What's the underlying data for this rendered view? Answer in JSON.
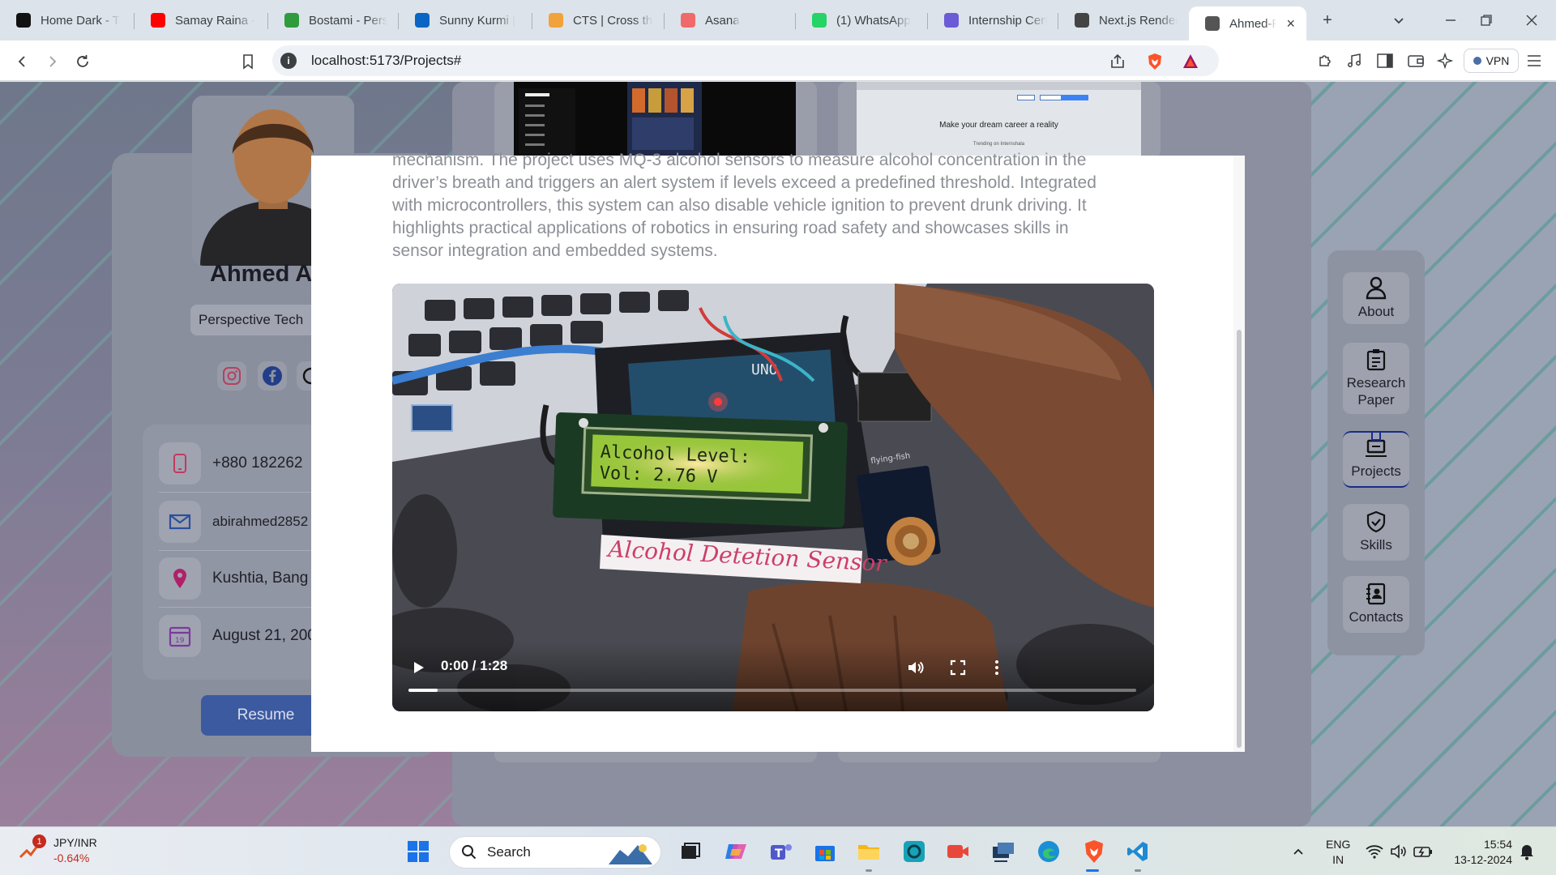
{
  "browser": {
    "tabs": [
      {
        "title": "Home Dark - T",
        "icon": "t-square-icon",
        "color": "#111111"
      },
      {
        "title": "Samay Raina -",
        "icon": "youtube-icon",
        "color": "#ff0000"
      },
      {
        "title": "Bostami - Pers",
        "icon": "bolt-icon",
        "color": "#2e9b3c"
      },
      {
        "title": "Sunny Kurmi |",
        "icon": "linkedin-icon",
        "color": "#0a66c2"
      },
      {
        "title": "CTS | Cross the",
        "icon": "icecream-icon",
        "color": "#f2a23a"
      },
      {
        "title": "Asana",
        "icon": "asana-icon",
        "color": "#f06a6a"
      },
      {
        "title": "(1) WhatsApp",
        "icon": "whatsapp-icon",
        "color": "#25d366"
      },
      {
        "title": "Internship Cert",
        "icon": "cert-icon",
        "color": "#6b5bd6"
      },
      {
        "title": "Next.js Render",
        "icon": "openai-icon",
        "color": "#444444"
      },
      {
        "title": "Ahmed-Po",
        "icon": "globe-icon",
        "color": "#555555",
        "active": true
      }
    ],
    "new_tab": "+",
    "url": "localhost:5173/Projects#",
    "vpn_label": "VPN"
  },
  "profile": {
    "name": "Ahmed Al",
    "role": "Perspective Tech",
    "contacts": [
      {
        "icon": "phone-icon",
        "text": "+880 182262"
      },
      {
        "icon": "mail-icon",
        "text": "abirahmed2852"
      },
      {
        "icon": "location-icon",
        "text": "Kushtia, Bang"
      },
      {
        "icon": "calendar-icon",
        "text": "August 21, 200"
      }
    ],
    "resume_label": "Resume"
  },
  "thumbnails": {
    "second_caption": "Make your dream career a reality",
    "second_sub": "Trending on Internshala"
  },
  "side_nav": {
    "items": [
      {
        "label": "About",
        "icon": "user-icon"
      },
      {
        "label": "Research Paper",
        "icon": "clipboard-icon"
      },
      {
        "label": "Projects",
        "icon": "laptop-icon",
        "active": true
      },
      {
        "label": "Skills",
        "icon": "shield-icon"
      },
      {
        "label": "Contacts",
        "icon": "address-book-icon"
      }
    ]
  },
  "modal": {
    "description_lines": [
      "mechanism. The project uses MQ-3 alcohol sensors to measure alcohol concentration in the",
      "driver’s breath and triggers an alert system if levels exceed a predefined threshold. Integrated",
      "with microcontrollers, this system can also disable vehicle ignition to prevent drunk driving. It",
      "highlights practical applications of robotics in ensuring road safety and showcases skills in",
      "sensor integration and embedded systems."
    ],
    "video": {
      "time": "0:00 / 1:28",
      "progress": 0.04,
      "lcd_line1": "Alcohol Level:",
      "lcd_line2": "Vol: 2.76 V",
      "label": "Alcohol Detetion Sensor",
      "board_text": "UNO",
      "module_text": "flying-fish"
    }
  },
  "taskbar": {
    "ticker_symbol": "JPY/INR",
    "ticker_change": "-0.64%",
    "notification_count": "1",
    "search_label": "Search",
    "lang_line1": "ENG",
    "lang_line2": "IN",
    "time": "15:54",
    "date": "13-12-2024"
  }
}
